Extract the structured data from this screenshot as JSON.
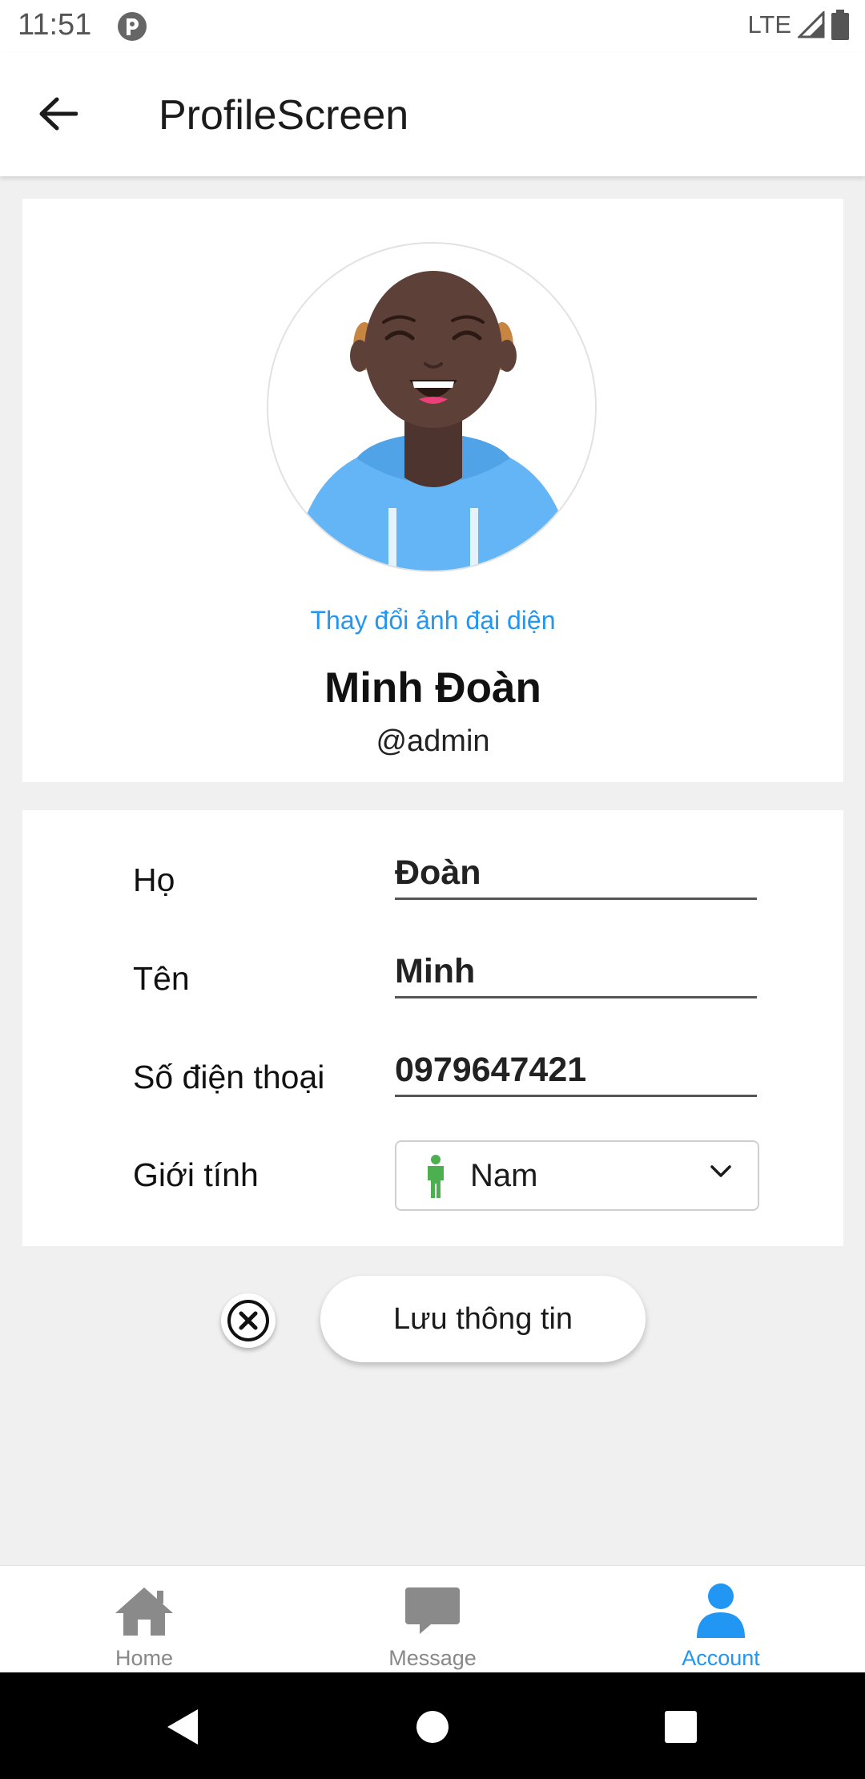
{
  "status_bar": {
    "time": "11:51",
    "network": "LTE"
  },
  "app_bar": {
    "title": "ProfileScreen"
  },
  "profile": {
    "change_photo_label": "Thay đổi ảnh đại diện",
    "full_name": "Minh Đoàn",
    "username": "@admin"
  },
  "form": {
    "fields": [
      {
        "label": "Họ",
        "value": "Đoàn"
      },
      {
        "label": "Tên",
        "value": "Minh"
      },
      {
        "label": "Số điện thoại",
        "value": "0979647421"
      }
    ],
    "gender": {
      "label": "Giới tính",
      "value": "Nam",
      "icon": "male-person-icon"
    }
  },
  "actions": {
    "save_label": "Lưu thông tin",
    "cancel_icon": "close-circle-icon"
  },
  "bottom_nav": {
    "items": [
      {
        "label": "Home",
        "icon": "home-icon"
      },
      {
        "label": "Message",
        "icon": "chat-icon"
      },
      {
        "label": "Account",
        "icon": "account-icon",
        "active": true
      }
    ]
  },
  "colors": {
    "accent": "#2196f3",
    "gender_icon": "#4caf50",
    "inactive_nav": "#888888"
  }
}
